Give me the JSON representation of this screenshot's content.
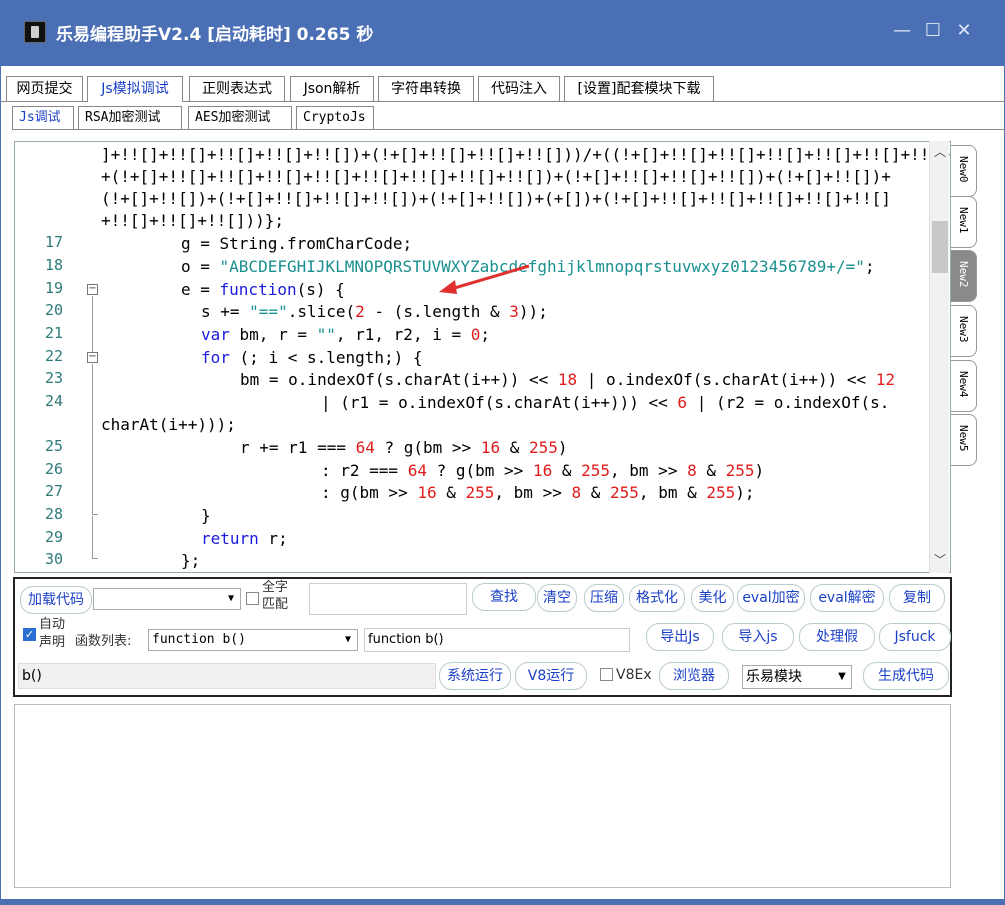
{
  "window": {
    "title": "乐易编程助手V2.4 [启动耗时] 0.265 秒",
    "minimize": "—",
    "maximize": "☐",
    "close": "✕"
  },
  "main_tabs": [
    "网页提交",
    "Js模拟调试",
    "正则表达式",
    "Json解析",
    "字符串转换",
    "代码注入",
    "[设置]配套模块下载"
  ],
  "sub_tabs": [
    "Js调试",
    "RSA加密测试",
    "AES加密测试",
    "CryptoJs"
  ],
  "right_tabs": [
    "New0",
    "New1",
    "New2",
    "New3",
    "New4",
    "New5"
  ],
  "code_lines": {
    "w1": "]+!![]+!![]+!![]+!![]+!![])+(!+[]+!![]+!![]+!![]))/+((!+[]+!![]+!![]+!![]+!![]+!![]+!![]+[])",
    "w2": "+(!+[]+!![]+!![]+!![]+!![]+!![]+!![]+!![]+!![])+(!+[]+!![]+!![]+!![])+(!+[]+!![])+",
    "w3": "(!+[]+!![])+(!+[]+!![]+!![]+!![])+(!+[]+!![])+(+[])+(!+[]+!![]+!![]+!![]+!![]+!![]",
    "w4": "+!![]+!![]+!![]))};",
    "l17": "g = String.fromCharCode;",
    "l18a": "o = ",
    "l18b": "\"ABCDEFGHIJKLMNOPQRSTUVWXYZabcdefghijklmnopqrstuvwxyz0123456789+/=\"",
    "l18c": ";",
    "l19a": "e = ",
    "l19b": "function",
    "l19c": "(s) {",
    "l20a": "s += ",
    "l20b": "\"==\"",
    "l20c": ".slice(",
    "l20d": "2",
    "l20e": " - (s.length & ",
    "l20f": "3",
    "l20g": "));",
    "l21a": "var",
    "l21b": " bm, r = ",
    "l21c": "\"\"",
    "l21d": ", r1, r2, i = ",
    "l21e": "0",
    "l21f": ";",
    "l22a": "for",
    "l22b": " (; i < s.length;) {",
    "l23a": "bm = o.indexOf(s.charAt(i++)) << ",
    "l23b": "18",
    "l23c": " | o.indexOf(s.charAt(i++)) << ",
    "l23d": "12",
    "l24a": "| (r1 = o.indexOf(s.charAt(i++))) << ",
    "l24b": "6",
    "l24c": " | (r2 = o.indexOf(s.",
    "l24w": "charAt(i++)));",
    "l25a": "r += r1 === ",
    "l25b": "64",
    "l25c": " ? g(bm >> ",
    "l25d": "16",
    "l25e": " & ",
    "l25f": "255",
    "l25g": ")",
    "l26a": ": r2 === ",
    "l26b": "64",
    "l26c": " ? g(bm >> ",
    "l26d": "16",
    "l26e": " & ",
    "l26f": "255",
    "l26g": ", bm >> ",
    "l26h": "8",
    "l26i": " & ",
    "l26j": "255",
    "l26k": ")",
    "l27a": ": g(bm >> ",
    "l27b": "16",
    "l27c": " & ",
    "l27d": "255",
    "l27e": ", bm >> ",
    "l27f": "8",
    "l27g": " & ",
    "l27h": "255",
    "l27i": ", bm & ",
    "l27j": "255",
    "l27k": ");",
    "l28": "}",
    "l29a": "return",
    "l29b": " r;",
    "l30": "};"
  },
  "line_numbers": [
    "17",
    "18",
    "19",
    "20",
    "21",
    "22",
    "23",
    "24",
    "25",
    "26",
    "27",
    "28",
    "29",
    "30"
  ],
  "toolbar": {
    "load_code": "加载代码",
    "whole_word_line1": "全字",
    "whole_word_line2": "匹配",
    "find": "查找",
    "clear": "清空",
    "compress": "压缩",
    "format": "格式化",
    "beautify": "美化",
    "eval_encrypt": "eval加密",
    "eval_decrypt": "eval解密",
    "copy": "复制",
    "auto_declare_line1": "自动",
    "auto_declare_line2": "声明",
    "function_list_label": "函数列表:",
    "function_list_value": "function b()",
    "function_text": "function b()",
    "export_js": "导出Js",
    "import_js": "导入js",
    "handle_fake": "处理假",
    "jsfuck": "Jsfuck",
    "call_input": "b()",
    "system_run": "系统运行",
    "v8_run": "V8运行",
    "v8ex": "V8Ex",
    "browser": "浏览器",
    "module_select": "乐易模块",
    "generate_code": "生成代码"
  },
  "colors": {
    "titlebar": "#4a6fb5",
    "accent_text": "#1a3fc7",
    "arrow": "#e03030"
  }
}
